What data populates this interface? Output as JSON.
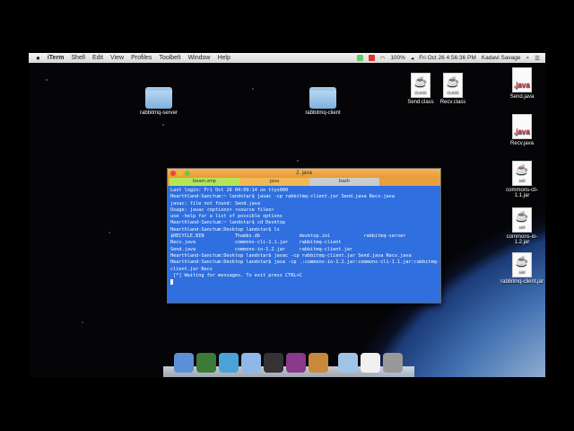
{
  "menubar": {
    "app": "iTerm",
    "items": [
      "Shell",
      "Edit",
      "View",
      "Profiles",
      "Toolbelt",
      "Window",
      "Help"
    ],
    "clock": "Fri Oct 26  4:56:36 PM",
    "user": "Kadavi Savage",
    "battery": "100%"
  },
  "desktop": {
    "icons": [
      {
        "label": "rabbitmq-server",
        "type": "folder"
      },
      {
        "label": "rabbitmq-client",
        "type": "folder"
      },
      {
        "label": "Send.class",
        "type": "class",
        "badge": "CLASS"
      },
      {
        "label": "Recv.class",
        "type": "class",
        "badge": "CLASS"
      },
      {
        "label": "Send.java",
        "type": "java",
        "badge": ".java"
      },
      {
        "label": "Recv.java",
        "type": "java",
        "badge": ".java"
      },
      {
        "label": "commons-cli-1.1.jar",
        "type": "jar",
        "badge": "JAR"
      },
      {
        "label": "commons-io-1.2.jar",
        "type": "jar",
        "badge": "JAR"
      },
      {
        "label": "rabbitmq-client.jar",
        "type": "jar",
        "badge": "JAR"
      }
    ]
  },
  "terminal": {
    "title": "2. java",
    "tabs": [
      "beam.smp",
      "java",
      "bash"
    ],
    "lines": [
      "Last login: Fri Oct 26 04:09:14 on ttys000",
      "Hearthland-Sanctum:~ landstar$ javac -cp rabbitmq-client.jar Send.java Recv.java",
      "javac: file not found: Send.java",
      "Usage: javac <options> <source files>",
      "use -help for a list of possible options",
      "Hearthland-Sanctum:~ landstar$ cd Desktop",
      "Hearthland-Sanctum:Desktop landstar$ ls",
      "$RECYCLE.BIN           Thumbs.db              desktop.ini            rabbitmq-server",
      "Recv.java              commons-cli-1.1.jar    rabbitmq-client",
      "Send.java              commons-io-1.2.jar     rabbitmq-client.jar",
      "Hearthland-Sanctum:Desktop landstar$ javac -cp rabbitmq-client.jar Send.java Recv.java",
      "Hearthland-Sanctum:Desktop landstar$ java -cp .:commons-io-1.2.jar:commons-cli-1.1.jar:rabbitmq-",
      "client.jar Recv",
      " [*] Waiting for messages. To exit press CTRL+C"
    ]
  },
  "dock": [
    "finder",
    "app-grass",
    "skitch",
    "safari",
    "terminal",
    "hd-app",
    "garageband",
    "applications-folder",
    "documents",
    "trash"
  ]
}
